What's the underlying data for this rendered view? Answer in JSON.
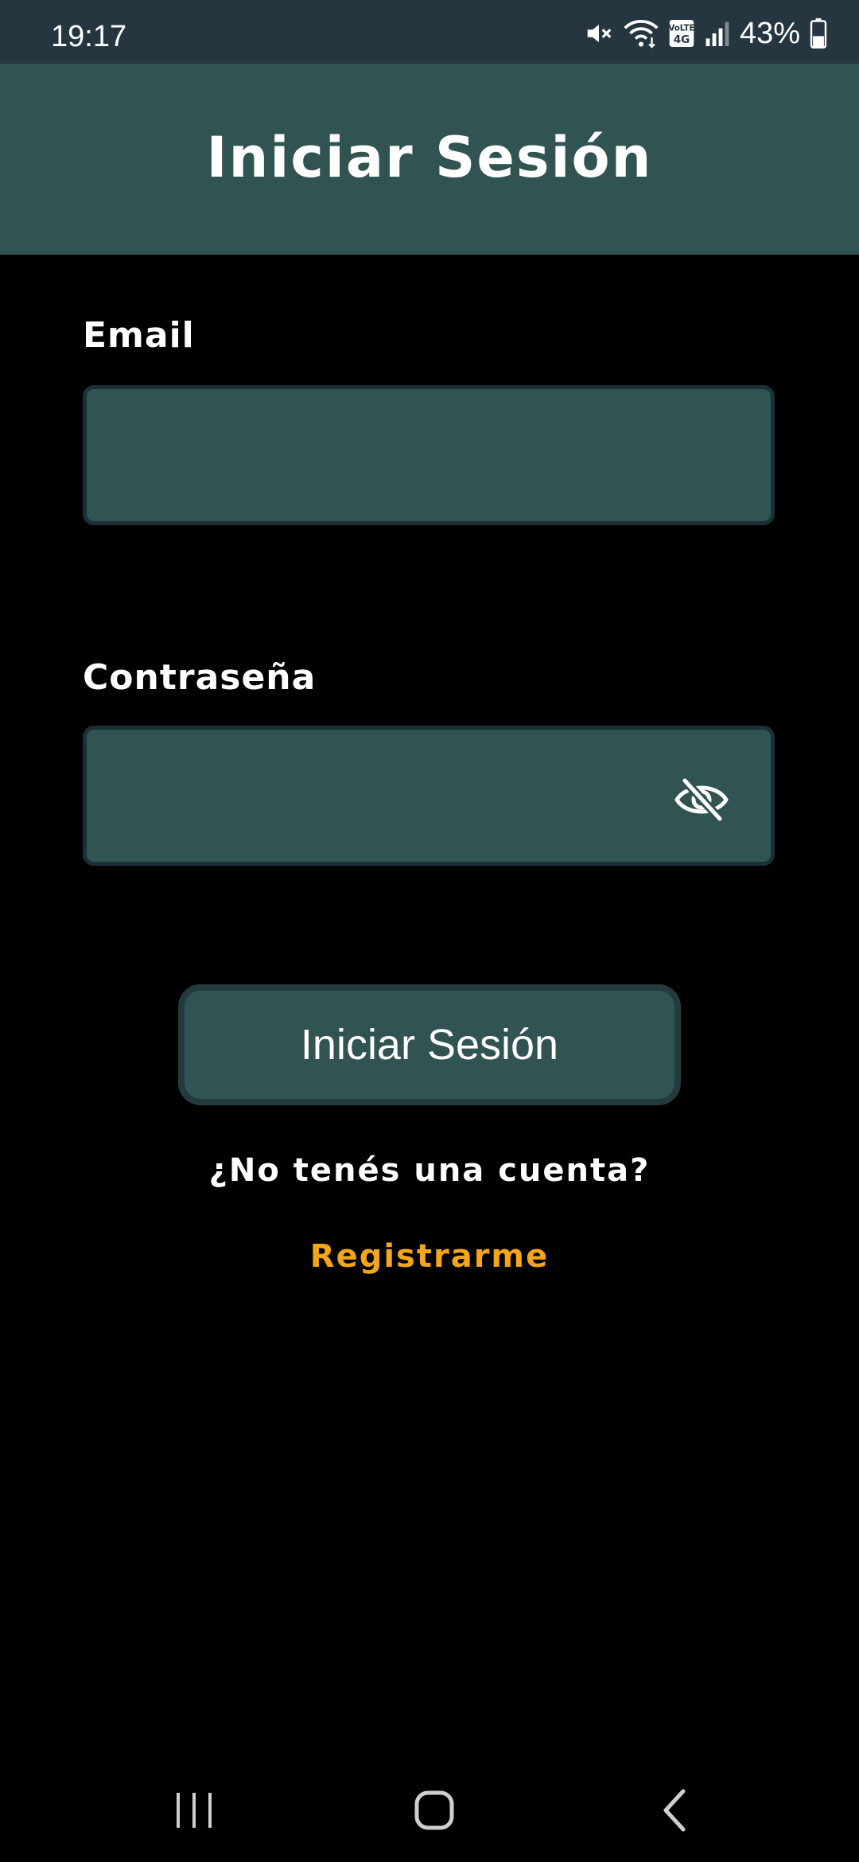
{
  "status_bar": {
    "time": "19:17",
    "battery_percent": "43%",
    "battery_level": 0.43,
    "icons": [
      "mute-icon",
      "wifi-icon",
      "volte-4g-icon",
      "signal-icon",
      "battery-icon"
    ],
    "volte_top": "VoLTE",
    "volte_bottom": "4G"
  },
  "header": {
    "title": "Iniciar Sesión"
  },
  "form": {
    "email": {
      "label": "Email",
      "value": "",
      "placeholder": ""
    },
    "password": {
      "label": "Contraseña",
      "value": "",
      "placeholder": "",
      "toggle_icon": "eye-off-icon"
    },
    "submit_label": "Iniciar Sesión"
  },
  "footer": {
    "no_account_text": "¿No tenés una cuenta?",
    "register_label": "Registrarme"
  },
  "nav_bar": {
    "icons": [
      "recent-apps-icon",
      "home-icon",
      "back-icon"
    ]
  },
  "colors": {
    "background": "#000000",
    "status_bar": "#253640",
    "primary": "#315351",
    "accent": "#f3a61c",
    "text": "#ffffff"
  }
}
